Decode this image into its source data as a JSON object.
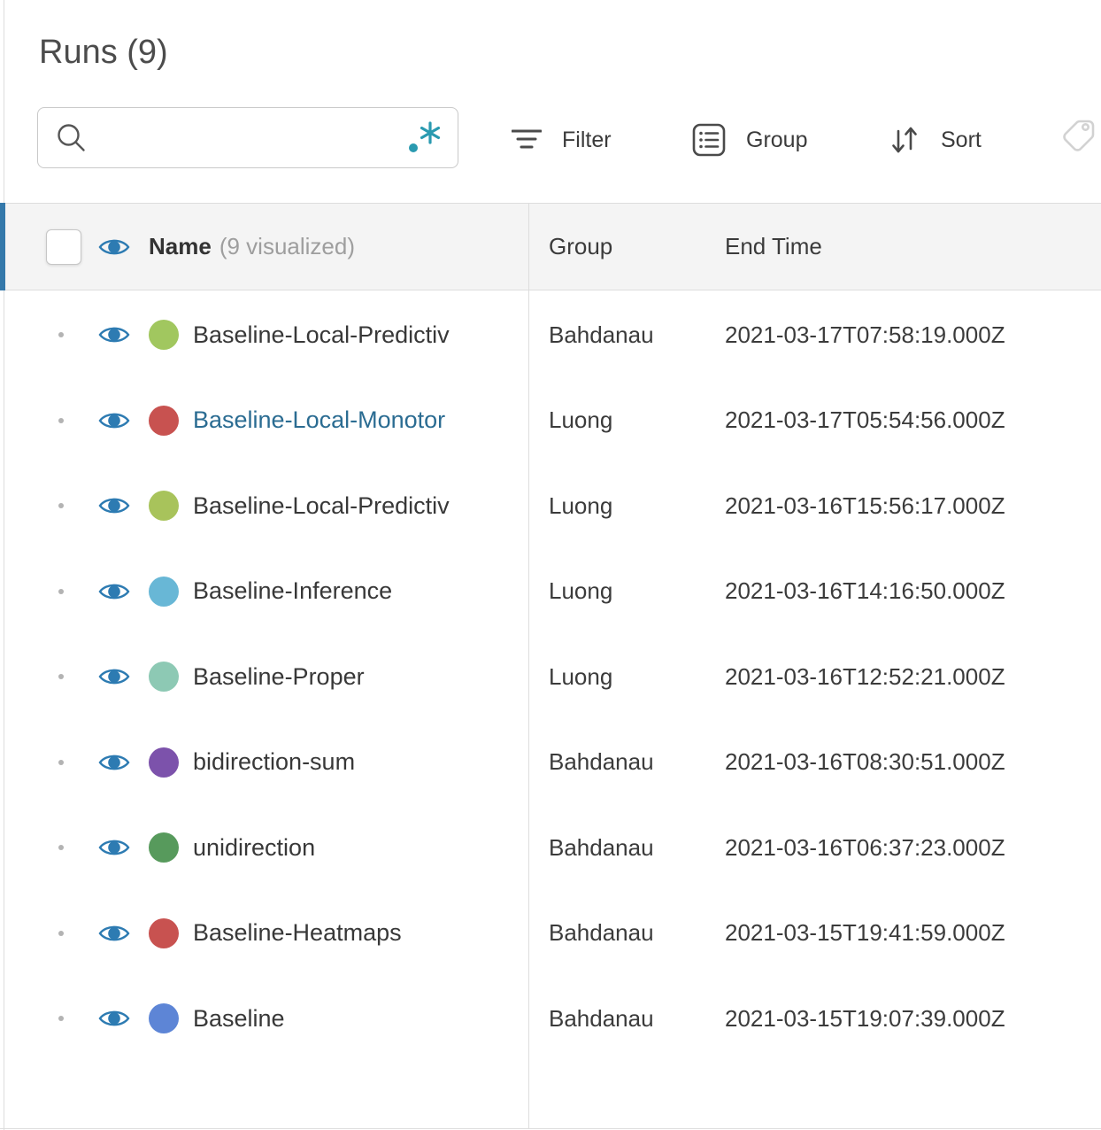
{
  "panel": {
    "title": "Runs (9)"
  },
  "search": {
    "value": "",
    "placeholder": ""
  },
  "toolbar": {
    "filter_label": "Filter",
    "group_label": "Group",
    "sort_label": "Sort"
  },
  "table": {
    "header": {
      "name_label": "Name",
      "name_suffix": "(9 visualized)",
      "group_label": "Group",
      "end_time_label": "End Time"
    },
    "rows": [
      {
        "name": "Baseline-Local-Predictiv",
        "color": "#a1c75f",
        "group": "Bahdanau",
        "end_time": "2021-03-17T07:58:19.000Z",
        "highlighted": false
      },
      {
        "name": "Baseline-Local-Monotor",
        "color": "#c85250",
        "group": "Luong",
        "end_time": "2021-03-17T05:54:56.000Z",
        "highlighted": true
      },
      {
        "name": "Baseline-Local-Predictiv",
        "color": "#a8c35b",
        "group": "Luong",
        "end_time": "2021-03-16T15:56:17.000Z",
        "highlighted": false
      },
      {
        "name": "Baseline-Inference",
        "color": "#68b7d6",
        "group": "Luong",
        "end_time": "2021-03-16T14:16:50.000Z",
        "highlighted": false
      },
      {
        "name": "Baseline-Proper",
        "color": "#8dc9b4",
        "group": "Luong",
        "end_time": "2021-03-16T12:52:21.000Z",
        "highlighted": false
      },
      {
        "name": "bidirection-sum",
        "color": "#7c52ab",
        "group": "Bahdanau",
        "end_time": "2021-03-16T08:30:51.000Z",
        "highlighted": false
      },
      {
        "name": "unidirection",
        "color": "#579a5c",
        "group": "Bahdanau",
        "end_time": "2021-03-16T06:37:23.000Z",
        "highlighted": false
      },
      {
        "name": "Baseline-Heatmaps",
        "color": "#c85250",
        "group": "Bahdanau",
        "end_time": "2021-03-15T19:41:59.000Z",
        "highlighted": false
      },
      {
        "name": "Baseline",
        "color": "#5d85d6",
        "group": "Bahdanau",
        "end_time": "2021-03-15T19:07:39.000Z",
        "highlighted": false
      }
    ]
  },
  "colors": {
    "eye_blue": "#2d7bb2",
    "indicator_blue": "#3478aa",
    "link_blue": "#2b6c92",
    "regex_teal": "#2a9ab0",
    "icon_gray": "#4a4a4a",
    "tag_gray": "#d2d2d2",
    "border_gray": "#dddddd"
  }
}
